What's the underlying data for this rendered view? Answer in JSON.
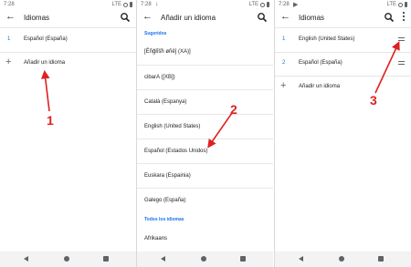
{
  "status": {
    "time": "7:28",
    "network_label": "LTE",
    "panel2_extra": "↓",
    "panel3_extra": "▶"
  },
  "panel1": {
    "title": "Idiomas",
    "languages": [
      {
        "num": "1",
        "label": "Español (España)"
      }
    ],
    "add_label": "Añadir un idioma"
  },
  "panel2": {
    "title": "Añadir un idioma",
    "suggested_header": "Sugeridos",
    "suggested": [
      "[Ĕñğłĩšħ øñê] (XA)]",
      "cibarA ([XB])",
      "Català (Espanya)",
      "English (United States)",
      "Español (Estados Unidos)",
      "Euskara (Espainia)",
      "Galego (España)"
    ],
    "all_header": "Todos los idiomas",
    "all": [
      "Afrikaans"
    ]
  },
  "panel3": {
    "title": "Idiomas",
    "languages": [
      {
        "num": "1",
        "label": "English (United States)"
      },
      {
        "num": "2",
        "label": "Español (España)"
      }
    ],
    "add_label": "Añadir un idioma"
  },
  "annotations": [
    "1",
    "2",
    "3"
  ],
  "colors": {
    "accent": "#1a73e8",
    "annotation": "#e02020"
  },
  "icons": [
    "back-arrow-icon",
    "search-icon",
    "more-vert-icon",
    "plus-icon",
    "drag-handle-icon"
  ]
}
